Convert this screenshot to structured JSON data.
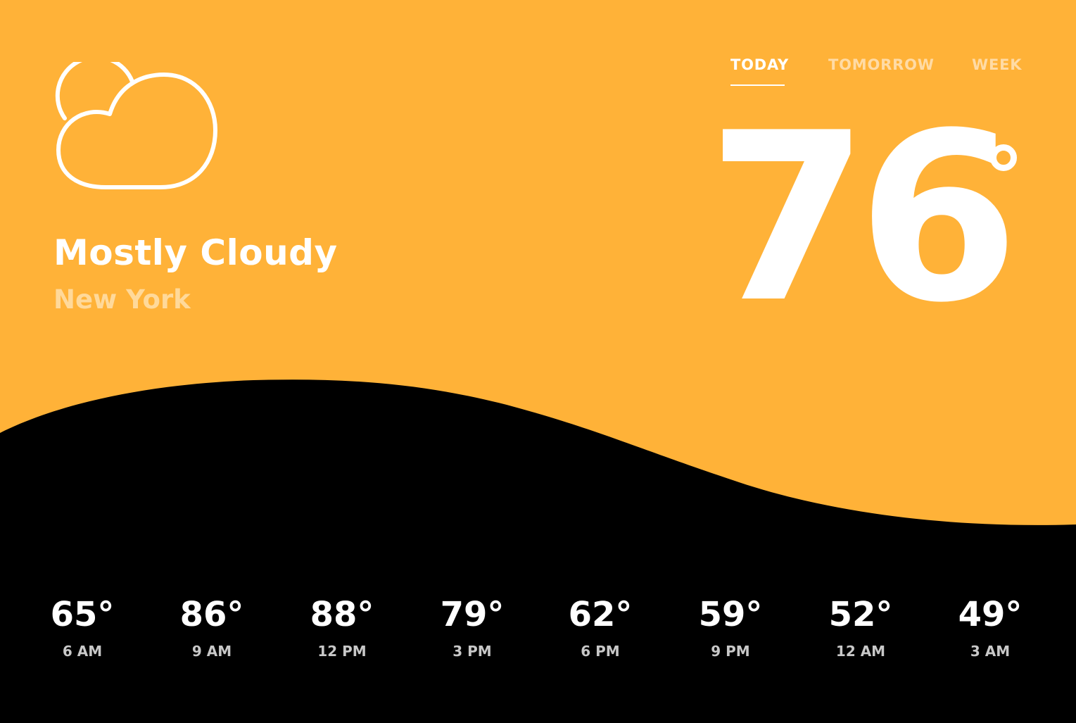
{
  "colors": {
    "accent": "#ffb238",
    "background": "#000000",
    "text_primary": "#ffffff",
    "location_text": "#ffd99a",
    "inactive_tab": "#ffdba5",
    "hour_label": "#c8c8c8"
  },
  "weather": {
    "icon": "cloud-icon",
    "condition": "Mostly Cloudy",
    "location": "New York",
    "temperature": "76"
  },
  "tabs": [
    {
      "label": "TODAY",
      "active": true
    },
    {
      "label": "TOMORROW",
      "active": false
    },
    {
      "label": "WEEK",
      "active": false
    }
  ],
  "hourly": [
    {
      "temp": "65°",
      "time": "6 AM"
    },
    {
      "temp": "86°",
      "time": "9 AM"
    },
    {
      "temp": "88°",
      "time": "12 PM"
    },
    {
      "temp": "79°",
      "time": "3 PM"
    },
    {
      "temp": "62°",
      "time": "6 PM"
    },
    {
      "temp": "59°",
      "time": "9 PM"
    },
    {
      "temp": "52°",
      "time": "12 AM"
    },
    {
      "temp": "49°",
      "time": "3 AM"
    }
  ]
}
